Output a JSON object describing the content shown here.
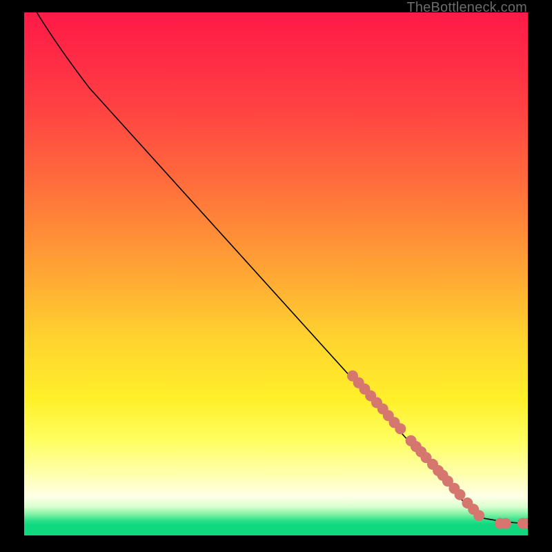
{
  "attribution": "TheBottleneck.com",
  "colors": {
    "point_fill": "#d5776e",
    "curve_stroke": "#000000",
    "panel_background": "#000000"
  },
  "chart_data": {
    "type": "line",
    "title": "",
    "xlabel": "",
    "ylabel": "",
    "xlim": [
      0,
      100
    ],
    "ylim": [
      0,
      100
    ],
    "curve": [
      {
        "x": 2.5,
        "y": 100
      },
      {
        "x": 7,
        "y": 93
      },
      {
        "x": 13,
        "y": 85.5
      },
      {
        "x": 90,
        "y": 3.5
      },
      {
        "x": 96.5,
        "y": 2.3
      },
      {
        "x": 100,
        "y": 2.3
      }
    ],
    "series": [
      {
        "name": "points",
        "type": "scatter",
        "points": [
          {
            "x": 65.2,
            "y": 30.5
          },
          {
            "x": 66.4,
            "y": 29.2
          },
          {
            "x": 67.6,
            "y": 28.0
          },
          {
            "x": 68.8,
            "y": 26.7
          },
          {
            "x": 70.0,
            "y": 25.4
          },
          {
            "x": 71.2,
            "y": 24.2
          },
          {
            "x": 72.3,
            "y": 22.9
          },
          {
            "x": 73.5,
            "y": 21.6
          },
          {
            "x": 74.7,
            "y": 20.4
          },
          {
            "x": 76.8,
            "y": 18.1
          },
          {
            "x": 77.8,
            "y": 17.0
          },
          {
            "x": 78.8,
            "y": 16.0
          },
          {
            "x": 79.8,
            "y": 14.9
          },
          {
            "x": 81.1,
            "y": 13.6
          },
          {
            "x": 82.2,
            "y": 12.4
          },
          {
            "x": 83.1,
            "y": 11.5
          },
          {
            "x": 84.1,
            "y": 10.4
          },
          {
            "x": 85.4,
            "y": 9.0
          },
          {
            "x": 86.5,
            "y": 7.8
          },
          {
            "x": 88.0,
            "y": 6.2
          },
          {
            "x": 89.2,
            "y": 5.0
          },
          {
            "x": 90.3,
            "y": 3.8
          },
          {
            "x": 94.5,
            "y": 2.3
          },
          {
            "x": 95.6,
            "y": 2.3
          },
          {
            "x": 99.0,
            "y": 2.3
          },
          {
            "x": 100,
            "y": 2.3
          }
        ]
      }
    ]
  }
}
